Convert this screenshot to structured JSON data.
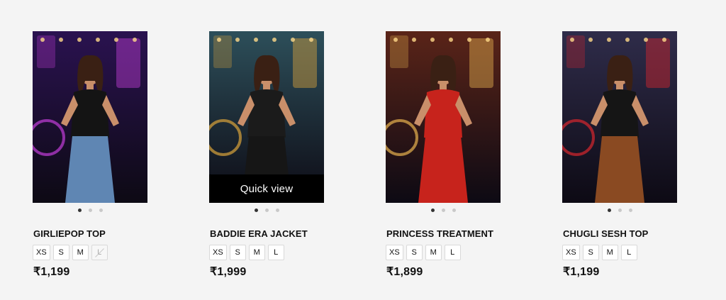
{
  "products": [
    {
      "name": "GIRLIEPOP TOP",
      "price": "₹1,199",
      "sizes": [
        {
          "label": "XS",
          "available": true
        },
        {
          "label": "S",
          "available": true
        },
        {
          "label": "M",
          "available": true
        },
        {
          "label": "L",
          "available": false
        }
      ],
      "image_index": 1,
      "image_count": 3,
      "palette": {
        "bg": "#2a1250",
        "accent": "#c23dd8",
        "garment": "#141414",
        "bottom": "#5f86b3"
      }
    },
    {
      "name": "BADDIE ERA JACKET",
      "price": "₹1,999",
      "quick_view": "Quick view",
      "sizes": [
        {
          "label": "XS",
          "available": true
        },
        {
          "label": "S",
          "available": true
        },
        {
          "label": "M",
          "available": true
        },
        {
          "label": "L",
          "available": true
        }
      ],
      "image_index": 1,
      "image_count": 3,
      "palette": {
        "bg": "#2d4f5a",
        "accent": "#d9a23b",
        "garment": "#1b1b1b",
        "bottom": "#161616"
      }
    },
    {
      "name": "PRINCESS TREATMENT",
      "price": "₹1,899",
      "sizes": [
        {
          "label": "XS",
          "available": true
        },
        {
          "label": "S",
          "available": true
        },
        {
          "label": "M",
          "available": true
        },
        {
          "label": "L",
          "available": true
        }
      ],
      "image_index": 1,
      "image_count": 3,
      "palette": {
        "bg": "#5a2418",
        "accent": "#e7b24f",
        "garment": "#c7231c",
        "bottom": "#c7231c"
      }
    },
    {
      "name": "CHUGLI SESH TOP",
      "price": "₹1,199",
      "sizes": [
        {
          "label": "XS",
          "available": true
        },
        {
          "label": "S",
          "available": true
        },
        {
          "label": "M",
          "available": true
        },
        {
          "label": "L",
          "available": true
        }
      ],
      "image_index": 1,
      "image_count": 3,
      "palette": {
        "bg": "#2f2c4a",
        "accent": "#d7262e",
        "garment": "#151515",
        "bottom": "#8a4a22"
      }
    }
  ]
}
